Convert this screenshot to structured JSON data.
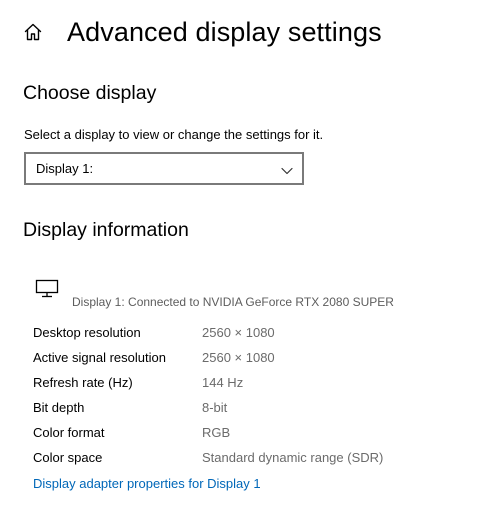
{
  "header": {
    "title": "Advanced display settings",
    "home_icon": "home-icon"
  },
  "choose_display": {
    "title": "Choose display",
    "description": "Select a display to view or change the settings for it.",
    "dropdown_value": "Display 1:",
    "dropdown_icon": "chevron-down-icon"
  },
  "display_information": {
    "title": "Display information",
    "monitor_icon": "monitor-icon",
    "connected_text": "Display 1: Connected to NVIDIA GeForce RTX 2080 SUPER",
    "rows": [
      {
        "label": "Desktop resolution",
        "value": "2560 × 1080"
      },
      {
        "label": "Active signal resolution",
        "value": "2560 × 1080"
      },
      {
        "label": "Refresh rate (Hz)",
        "value": "144 Hz"
      },
      {
        "label": "Bit depth",
        "value": "8-bit"
      },
      {
        "label": "Color format",
        "value": "RGB"
      },
      {
        "label": "Color space",
        "value": "Standard dynamic range (SDR)"
      }
    ],
    "adapter_link": "Display adapter properties for Display 1"
  },
  "colors": {
    "link": "#0067b8",
    "secondary_text": "#6b6b6b",
    "border": "#7a7a7a"
  }
}
